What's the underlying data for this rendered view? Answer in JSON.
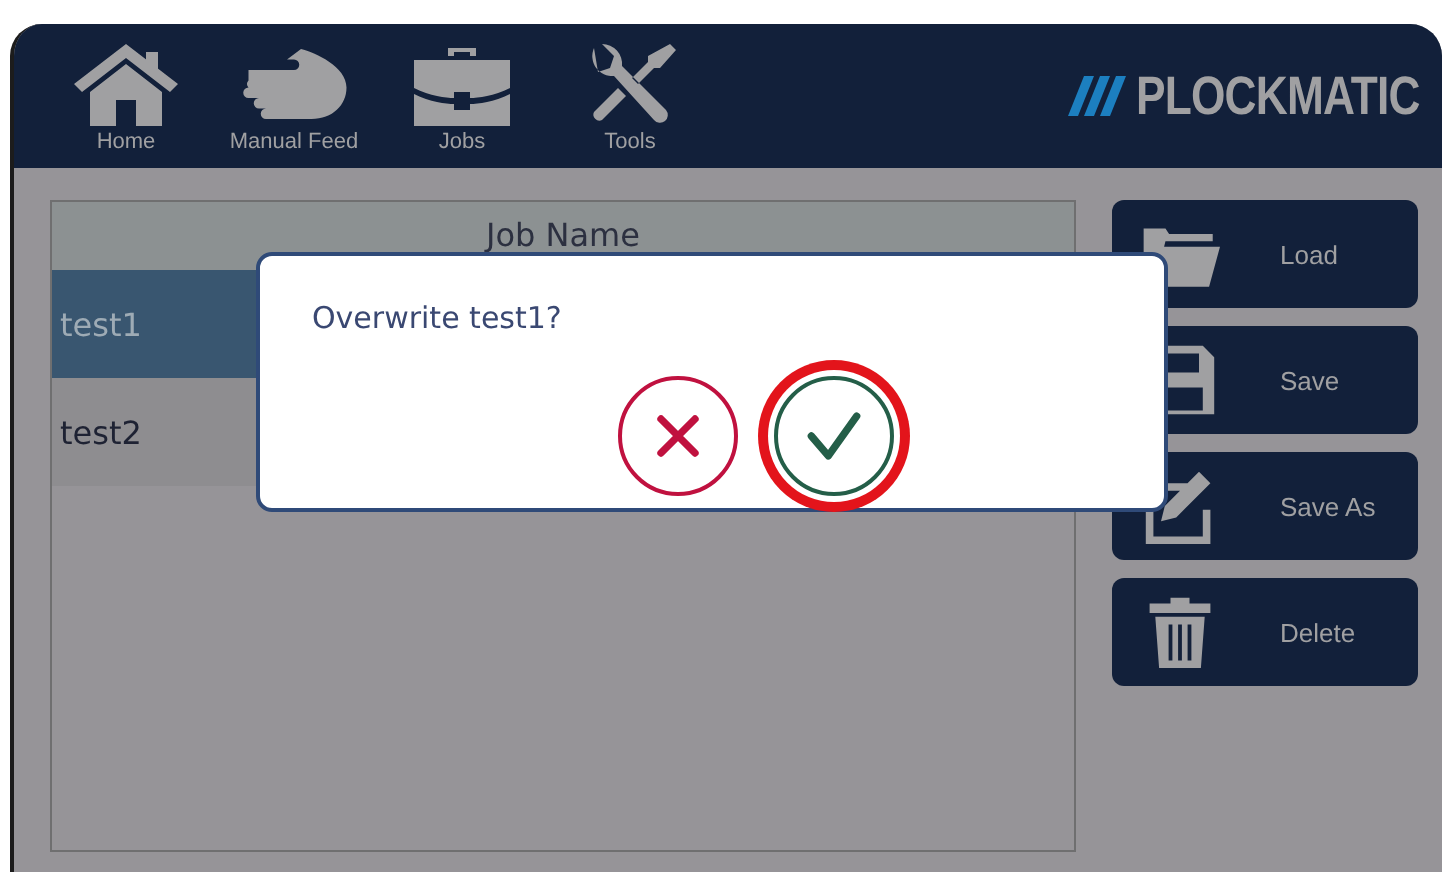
{
  "header": {
    "nav": [
      {
        "label": "Home",
        "kind": "home"
      },
      {
        "label": "Manual Feed",
        "kind": "hand"
      },
      {
        "label": "Jobs",
        "kind": "jobs"
      },
      {
        "label": "Tools",
        "kind": "tools"
      }
    ],
    "logo": "PLOCKMATIC"
  },
  "table": {
    "columns": [
      "Job Name"
    ],
    "rows": [
      {
        "cells": [
          "test1"
        ],
        "selected": true
      },
      {
        "cells": [
          "test2"
        ],
        "selected": false
      }
    ]
  },
  "actions": [
    {
      "label": "Load",
      "kind": "load"
    },
    {
      "label": "Save",
      "kind": "save"
    },
    {
      "label": "Save As",
      "kind": "saveas"
    },
    {
      "label": "Delete",
      "kind": "delete"
    }
  ],
  "dialog": {
    "message": "Overwrite test1?",
    "buttons": [
      {
        "kind": "cancel",
        "highlighted": false
      },
      {
        "kind": "confirm",
        "highlighted": true
      }
    ]
  }
}
